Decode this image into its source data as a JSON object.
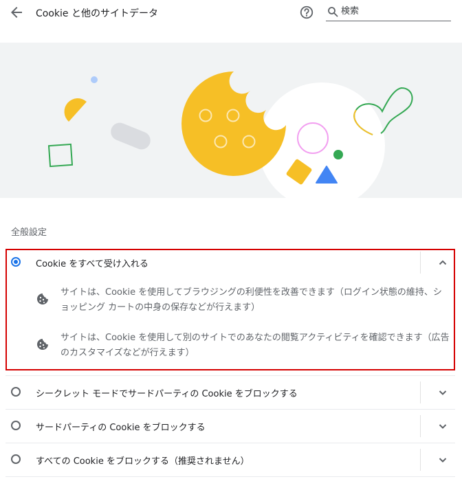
{
  "header": {
    "title": "Cookie と他のサイトデータ",
    "search_placeholder": "検索",
    "search_value": ""
  },
  "section_title": "全般設定",
  "options": [
    {
      "label": "Cookie をすべて受け入れる",
      "selected": true,
      "expanded": true,
      "details": [
        "サイトは、Cookie を使用してブラウジングの利便性を改善できます（ログイン状態の維持、ショッピング カートの中身の保存などが行えます）",
        "サイトは、Cookie を使用して別のサイトでのあなたの閲覧アクティビティを確認できます（広告のカスタマイズなどが行えます）"
      ]
    },
    {
      "label": "シークレット モードでサードパーティの Cookie をブロックする",
      "selected": false,
      "expanded": false
    },
    {
      "label": "サードパーティの Cookie をブロックする",
      "selected": false,
      "expanded": false
    },
    {
      "label": "すべての Cookie をブロックする（推奨されません）",
      "selected": false,
      "expanded": false
    }
  ],
  "icons": {
    "back": "arrow-back-icon",
    "help": "help-circle-icon",
    "search": "search-icon",
    "detail": "cookie-icon",
    "expanded": "chevron-up-icon",
    "collapsed": "chevron-down-icon"
  },
  "colors": {
    "accent": "#1a73e8",
    "highlight_border": "#d50000",
    "cookie_yellow": "#f6bf26",
    "google_green": "#34a853",
    "google_blue": "#4285f4",
    "illustration_bg": "#f1f3f4"
  }
}
